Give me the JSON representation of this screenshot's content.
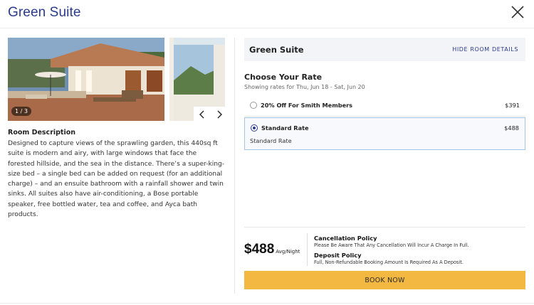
{
  "modal": {
    "title": "Green Suite"
  },
  "gallery": {
    "counter": "1 / 3"
  },
  "description": {
    "title": "Room Description",
    "text": "Designed to capture views of the sprawling garden, this 440sq ft suite is modern and airy, with large windows that face the forested hillside, and the sea in the distance. There’s a super-king-size bed – a single bed can be added on request (for an additional charge) – and an ensuite bathroom with a rainfall shower and twin sinks. All suites also have air-conditioning, a Bose portable speaker, free bottled water, tea and coffee, and Ayca bath products."
  },
  "room_panel": {
    "name": "Green Suite",
    "hide_link": "HIDE ROOM DETAILS"
  },
  "rates": {
    "title": "Choose Your Rate",
    "subtitle": "Showing rates for Thu, Jun 18 - Sat, Jun 20",
    "options": [
      {
        "label": "20% Off For Smith Members",
        "price": "$391",
        "selected": false
      },
      {
        "label": "Standard Rate",
        "price": "$488",
        "selected": true,
        "detail": "Standard Rate"
      }
    ]
  },
  "summary": {
    "price": "$488",
    "unit": "Avg/Night",
    "cancellation_title": "Cancellation Policy",
    "cancellation_text": "Please Be Aware That Any Cancellation Will Incur A Charge In Full.",
    "deposit_title": "Deposit Policy",
    "deposit_text": "Full, Non-Refundable Booking Amount Is Required As A Deposit."
  },
  "book_button": {
    "label": "BOOK NOW"
  },
  "colors": {
    "brand": "#2b3a8c",
    "cta": "#f2b842",
    "panel": "#f3f4f7"
  },
  "icons": [
    "close-icon",
    "chevron-left-icon",
    "chevron-right-icon",
    "radio-icon"
  ]
}
